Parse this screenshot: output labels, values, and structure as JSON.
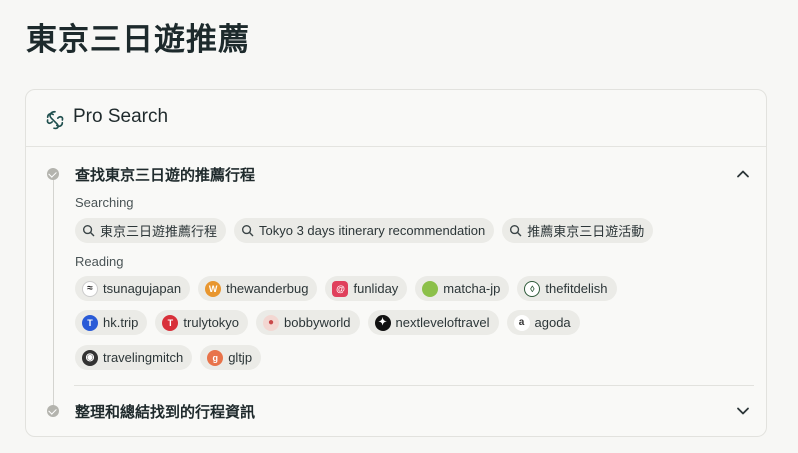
{
  "page": {
    "title": "東京三日遊推薦"
  },
  "pro_search": {
    "title": "Pro Search",
    "steps": [
      {
        "title": "查找東京三日遊的推薦行程",
        "expanded": true,
        "searching_label": "Searching",
        "queries": [
          "東京三日遊推薦行程",
          "Tokyo 3 days itinerary recommendation",
          "推薦東京三日遊活動"
        ],
        "reading_label": "Reading",
        "sources": [
          {
            "name": "tsunagujapan",
            "icon": "tsunagujapan-favicon",
            "color": "#ffffff"
          },
          {
            "name": "thewanderbug",
            "icon": "thewanderbug-favicon",
            "color": "#e8962f"
          },
          {
            "name": "funliday",
            "icon": "funliday-favicon",
            "color": "#e0405c"
          },
          {
            "name": "matcha-jp",
            "icon": "matcha-jp-favicon",
            "color": "#8cc04a"
          },
          {
            "name": "thefitdelish",
            "icon": "thefitdelish-favicon",
            "color": "#2f5b3a"
          },
          {
            "name": "hk.trip",
            "icon": "hk-trip-favicon",
            "color": "#2a5bd7"
          },
          {
            "name": "trulytokyo",
            "icon": "trulytokyo-favicon",
            "color": "#d8303a"
          },
          {
            "name": "bobbyworld",
            "icon": "bobbyworld-favicon",
            "color": "#c9494a"
          },
          {
            "name": "nextleveloftravel",
            "icon": "nextleveloftravel-favicon",
            "color": "#111111"
          },
          {
            "name": "agoda",
            "icon": "agoda-favicon",
            "color": "#ffffff"
          },
          {
            "name": "travelingmitch",
            "icon": "travelingmitch-favicon",
            "color": "#333333"
          },
          {
            "name": "gltjp",
            "icon": "gltjp-favicon",
            "color": "#e8734a"
          }
        ]
      },
      {
        "title": "整理和總結找到的行程資訊",
        "expanded": false
      }
    ]
  }
}
